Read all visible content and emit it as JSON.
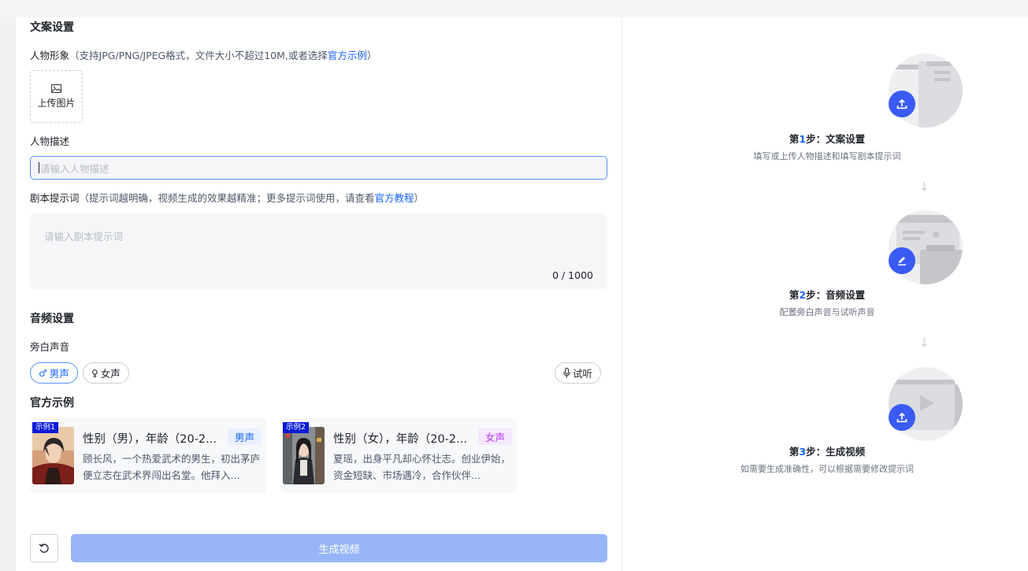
{
  "copy_section": {
    "title": "文案设置",
    "avatar_label": "人物形象",
    "avatar_hint": "（支持JPG/PNG/JPEG格式，文件大小不超过10M,或者选择",
    "avatar_link": "官方示例",
    "avatar_hint_end": "）",
    "upload_label": "上传图片",
    "desc_label": "人物描述",
    "desc_placeholder": "请输入人物描述",
    "script_label": "剧本提示词",
    "script_hint": "（提示词越明确，视频生成的效果越精准；更多提示词使用，请查看",
    "script_link": "官方教程",
    "script_hint_end": "）",
    "script_placeholder": "请输入剧本提示词",
    "char_count": "0 / 1000"
  },
  "audio_section": {
    "title": "音频设置",
    "narration_label": "旁白声音",
    "male_label": "男声",
    "female_label": "女声",
    "preview_label": "试听",
    "selected": "男声"
  },
  "examples_section": {
    "title": "官方示例",
    "cards": [
      {
        "tag": "示例1",
        "title": "性别（男），年龄（20-2...",
        "badge": "男声",
        "badge_color": "#1664ff",
        "badge_bg": "#e8f0ff",
        "desc": "顾长风，一个热爱武术的男生，初出茅庐便立志在武术界闯出名堂。他拜入..."
      },
      {
        "tag": "示例2",
        "title": "性别（女），年龄（20-2...",
        "badge": "女声",
        "badge_color": "#b23cf0",
        "badge_bg": "#f5e8ff",
        "desc": "夏瑶，出身平凡却心怀壮志。创业伊始，资金短缺、市场遇冷，合作伙伴..."
      }
    ]
  },
  "actions": {
    "generate_label": "生成视频"
  },
  "steps": [
    {
      "prefix": "第",
      "num": "1",
      "suffix": "步：文案设置",
      "desc": "填写或上传人物描述和填写剧本提示词",
      "icon": "upload-icon"
    },
    {
      "prefix": "第",
      "num": "2",
      "suffix": "步：音频设置",
      "desc": "配置旁白声音与试听声音",
      "icon": "edit-icon"
    },
    {
      "prefix": "第",
      "num": "3",
      "suffix": "步：生成视频",
      "desc": "如需要生成准确性，可以根据需要修改提示词",
      "icon": "upload-icon"
    }
  ],
  "colors": {
    "accent": "#1664ff",
    "step_badge": "#3a5af5",
    "generate_disabled": "#98b6f7"
  }
}
